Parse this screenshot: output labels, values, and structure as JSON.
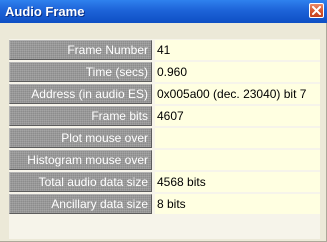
{
  "window": {
    "title": "Audio Frame"
  },
  "fields": [
    {
      "label": "Frame Number",
      "value": "41"
    },
    {
      "label": "Time (secs)",
      "value": "0.960"
    },
    {
      "label": "Address (in audio ES)",
      "value": "0x005a00 (dec. 23040) bit 7"
    },
    {
      "label": "Frame bits",
      "value": "4607"
    },
    {
      "label": "Plot mouse over",
      "value": ""
    },
    {
      "label": "Histogram mouse over",
      "value": ""
    },
    {
      "label": "Total audio data size",
      "value": "4568 bits"
    },
    {
      "label": "Ancillary data size",
      "value": "8 bits"
    }
  ],
  "icons": {
    "close": "close-icon"
  },
  "colors": {
    "titlebar": "#1d63d8",
    "label_bg": "#8c8c8c",
    "value_bg": "#ffffe1",
    "window_bg": "#ece9d8",
    "close_button": "#d5562f"
  }
}
